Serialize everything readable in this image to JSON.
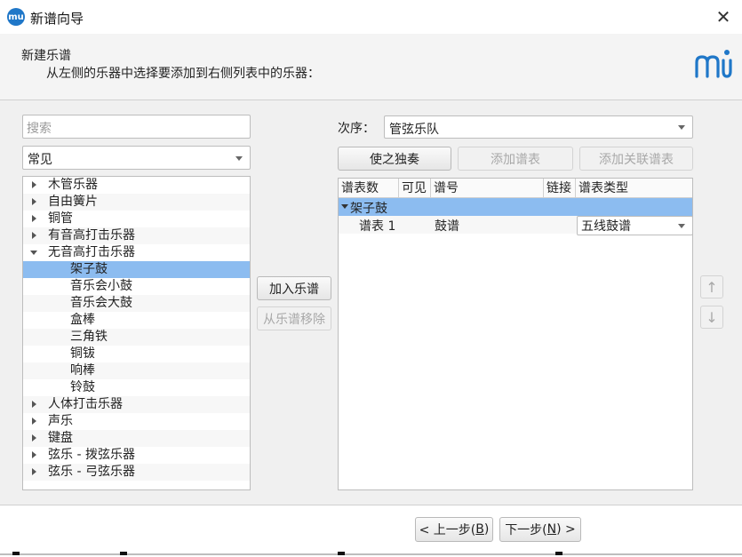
{
  "window": {
    "title": "新谱向导",
    "close_glyph": "✕",
    "app_icon_text": "mu"
  },
  "header": {
    "title": "新建乐谱",
    "subtitle": "从左侧的乐器中选择要添加到右侧列表中的乐器："
  },
  "left_panel": {
    "search_placeholder": "搜索",
    "category": "常见",
    "tree": [
      {
        "label": "木管乐器",
        "level": 0,
        "state": "collapsed"
      },
      {
        "label": "自由簧片",
        "level": 0,
        "state": "collapsed"
      },
      {
        "label": "铜管",
        "level": 0,
        "state": "collapsed"
      },
      {
        "label": "有音高打击乐器",
        "level": 0,
        "state": "collapsed"
      },
      {
        "label": "无音高打击乐器",
        "level": 0,
        "state": "expanded"
      },
      {
        "label": "架子鼓",
        "level": 1,
        "state": "selected"
      },
      {
        "label": "音乐会小鼓",
        "level": 1
      },
      {
        "label": "音乐会大鼓",
        "level": 1
      },
      {
        "label": "盒棒",
        "level": 1
      },
      {
        "label": "三角铁",
        "level": 1
      },
      {
        "label": "铜钹",
        "level": 1
      },
      {
        "label": "响棒",
        "level": 1
      },
      {
        "label": "铃鼓",
        "level": 1
      },
      {
        "label": "人体打击乐器",
        "level": 0,
        "state": "collapsed"
      },
      {
        "label": "声乐",
        "level": 0,
        "state": "collapsed"
      },
      {
        "label": "键盘",
        "level": 0,
        "state": "collapsed"
      },
      {
        "label": "弦乐 - 拨弦乐器",
        "level": 0,
        "state": "collapsed"
      },
      {
        "label": "弦乐 - 弓弦乐器",
        "level": 0,
        "state": "collapsed"
      }
    ]
  },
  "middle_buttons": {
    "add": "加入乐谱",
    "remove": "从乐谱移除"
  },
  "right_panel": {
    "order_label": "次序：",
    "order_value": "管弦乐队",
    "solo_button": "使之独奏",
    "add_staff_button": "添加谱表",
    "add_linked_staff_button": "添加关联谱表",
    "columns": [
      "谱表数",
      "可见",
      "谱号",
      "链接",
      "谱表类型"
    ],
    "group": {
      "name": "架子鼓"
    },
    "staff": {
      "name": "谱表 1",
      "clef": "鼓谱",
      "staff_type": "五线鼓谱"
    }
  },
  "arrows": {
    "up": "↑",
    "down": "↓"
  },
  "footer": {
    "back": {
      "prefix": "< 上一步(",
      "key": "B",
      "suffix": ")"
    },
    "next": {
      "prefix": "下一步(",
      "key": "N",
      "suffix": ") >"
    }
  }
}
